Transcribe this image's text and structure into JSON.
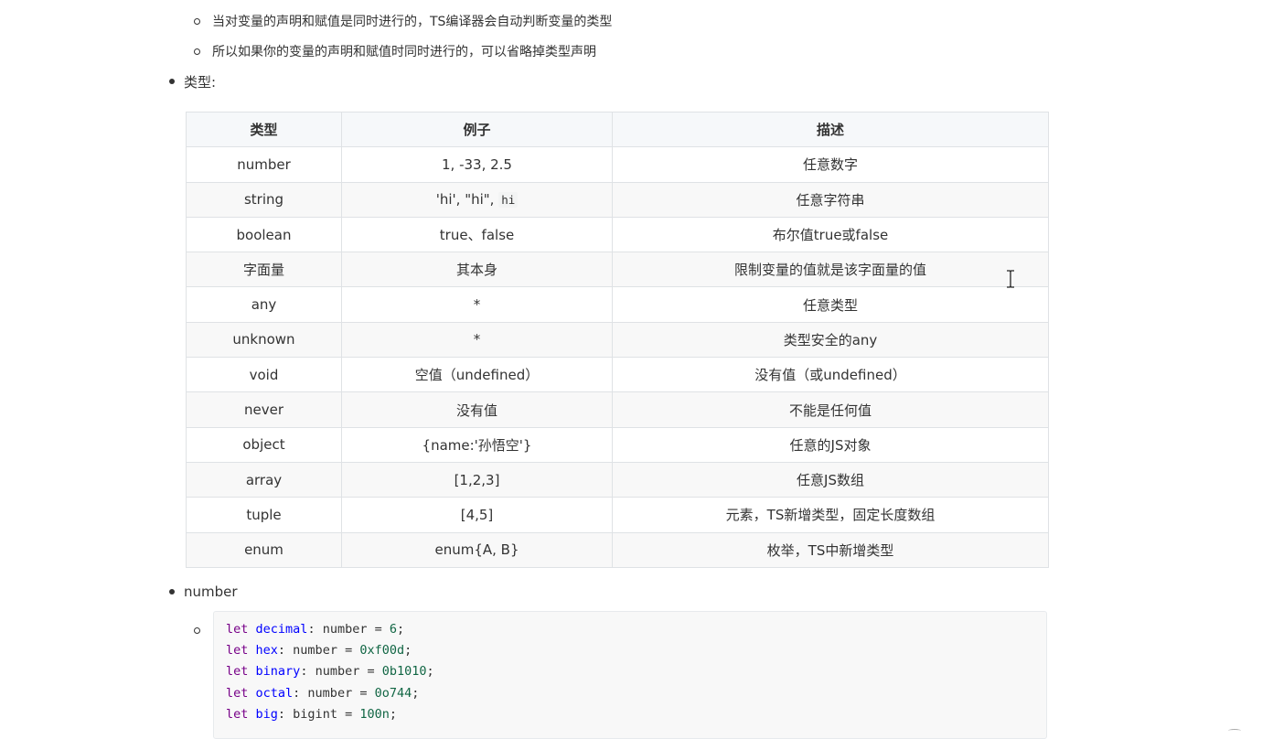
{
  "bullets": {
    "sub1": "当对变量的声明和赋值是同时进行的，TS编译器会自动判断变量的类型",
    "sub2": "所以如果你的变量的声明和赋值时同时进行的，可以省略掉类型声明",
    "types_heading": "类型:",
    "number_heading": "number"
  },
  "table": {
    "headers": [
      "类型",
      "例子",
      "描述"
    ],
    "rows": [
      {
        "type": "number",
        "example": "1, -33, 2.5",
        "desc": "任意数字"
      },
      {
        "type": "string",
        "example_prefix": "'hi', \"hi\", ",
        "example_code": "hi",
        "desc": "任意字符串"
      },
      {
        "type": "boolean",
        "example": "true、false",
        "desc": "布尔值true或false"
      },
      {
        "type": "字面量",
        "example": "其本身",
        "desc": "限制变量的值就是该字面量的值"
      },
      {
        "type": "any",
        "example": "*",
        "desc": "任意类型"
      },
      {
        "type": "unknown",
        "example": "*",
        "desc": "类型安全的any"
      },
      {
        "type": "void",
        "example": "空值（undefined）",
        "desc": "没有值（或undefined）"
      },
      {
        "type": "never",
        "example": "没有值",
        "desc": "不能是任何值"
      },
      {
        "type": "object",
        "example": "{name:'孙悟空'}",
        "desc": "任意的JS对象"
      },
      {
        "type": "array",
        "example": "[1,2,3]",
        "desc": "任意JS数组"
      },
      {
        "type": "tuple",
        "example": "[4,5]",
        "desc": "元素，TS新增类型，固定长度数组"
      },
      {
        "type": "enum",
        "example": "enum{A, B}",
        "desc": "枚举，TS中新增类型"
      }
    ]
  },
  "code": {
    "lines": [
      {
        "kw": "let",
        "name": "decimal",
        "mid": ": number = ",
        "value": "6",
        "end": ";"
      },
      {
        "kw": "let",
        "name": "hex",
        "mid": ": number = ",
        "value": "0xf00d",
        "end": ";"
      },
      {
        "kw": "let",
        "name": "binary",
        "mid": ": number = ",
        "value": "0b1010",
        "end": ";"
      },
      {
        "kw": "let",
        "name": "octal",
        "mid": ": number = ",
        "value": "0o744",
        "end": ";"
      },
      {
        "kw": "let",
        "name": "big",
        "mid": ": bigint = ",
        "value": "100n",
        "end": ";"
      }
    ]
  },
  "colors": {
    "keyword": "#770088",
    "variable": "#0000ff",
    "number": "#116644",
    "table_border": "#dfe2e5",
    "header_bg": "#f6f8fa"
  },
  "icons": {
    "cursor": "text-ibeam-cursor-icon"
  }
}
